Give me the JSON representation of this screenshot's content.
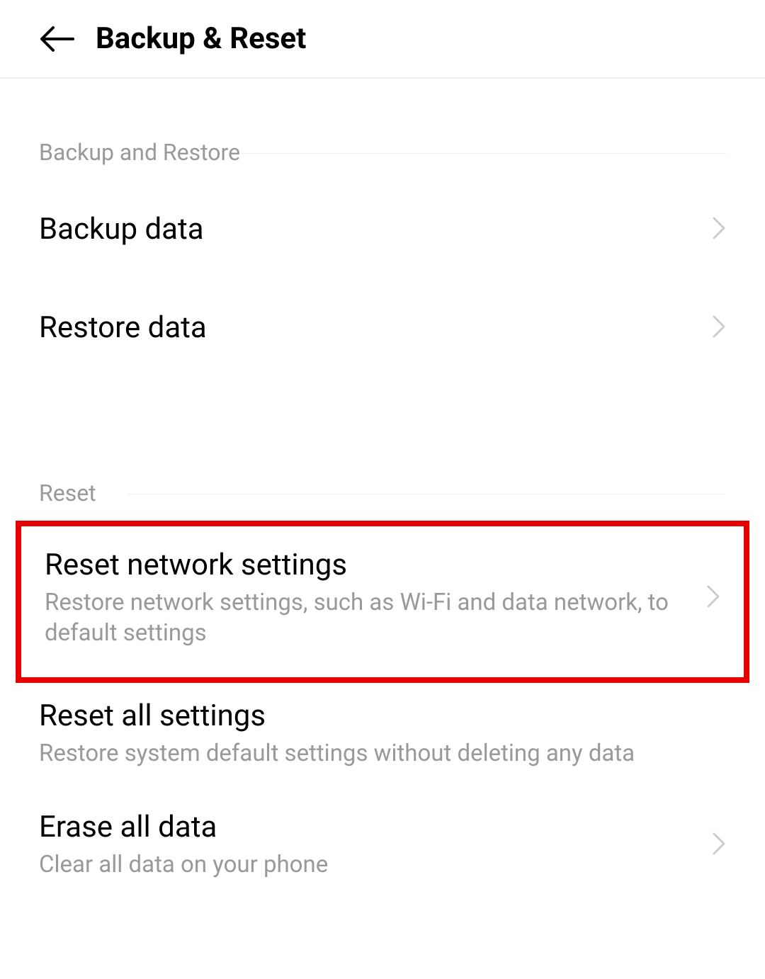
{
  "header": {
    "title": "Backup & Reset"
  },
  "sections": {
    "backup": {
      "header": "Backup and Restore",
      "items": {
        "backup_data": {
          "title": "Backup data"
        },
        "restore_data": {
          "title": "Restore data"
        }
      }
    },
    "reset": {
      "header": "Reset",
      "items": {
        "reset_network": {
          "title": "Reset network settings",
          "subtitle": "Restore network settings, such as Wi-Fi and data network, to default settings"
        },
        "reset_all": {
          "title": "Reset all settings",
          "subtitle": "Restore system default settings without deleting any data"
        },
        "erase_all": {
          "title": "Erase all data",
          "subtitle": "Clear all data on your phone"
        }
      }
    }
  }
}
